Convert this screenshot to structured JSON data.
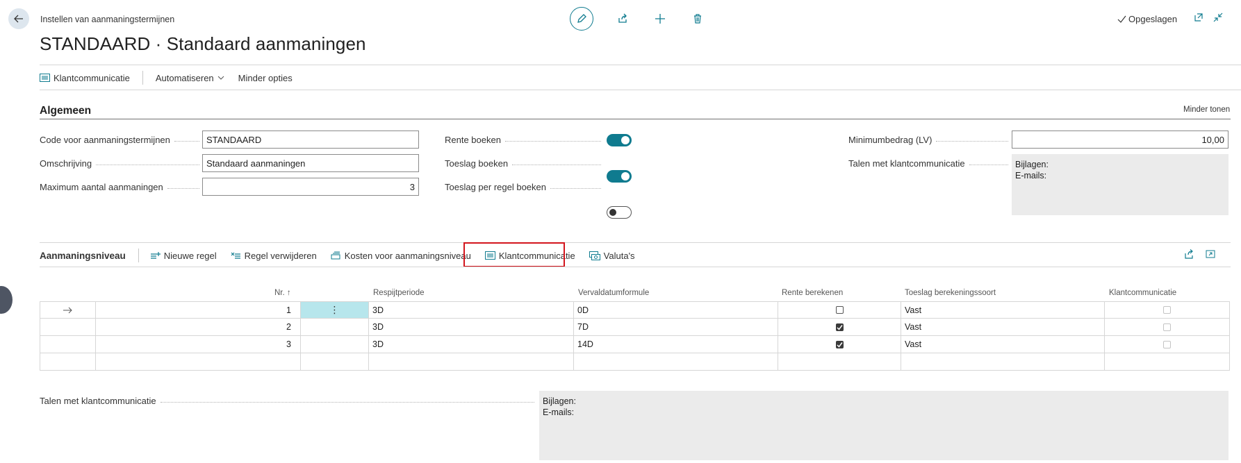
{
  "header": {
    "breadcrumb": "Instellen van aanmaningstermijnen",
    "title": "STANDAARD · Standaard aanmaningen",
    "saved_label": "Opgeslagen"
  },
  "actions": {
    "klantcommunicatie": "Klantcommunicatie",
    "automatiseren": "Automatiseren",
    "minder_opties": "Minder opties"
  },
  "general": {
    "section_title": "Algemeen",
    "less_label": "Minder tonen",
    "code_label": "Code voor aanmaningstermijnen",
    "code_value": "STANDAARD",
    "omschrijving_label": "Omschrijving",
    "omschrijving_value": "Standaard aanmaningen",
    "max_label": "Maximum aantal aanmaningen",
    "max_value": "3",
    "rente_label": "Rente boeken",
    "rente_on": true,
    "toeslag_label": "Toeslag boeken",
    "toeslag_on": true,
    "toeslag_regel_label": "Toeslag per regel boeken",
    "toeslag_regel_on": false,
    "minimum_label": "Minimumbedrag (LV)",
    "minimum_value": "10,00",
    "talen_label": "Talen met klantcommunicatie",
    "bijlagen": "Bijlagen:",
    "emails": "E-mails:"
  },
  "subpage": {
    "title": "Aanmaningsniveau",
    "nieuwe_regel": "Nieuwe regel",
    "regel_verwijderen": "Regel verwijderen",
    "kosten": "Kosten voor aanmaningsniveau",
    "klantcommunicatie": "Klantcommunicatie",
    "valuta": "Valuta's"
  },
  "grid": {
    "columns": {
      "nr": "Nr. ↑",
      "respijt": "Respijtperiode",
      "verval": "Vervaldatumformule",
      "rente": "Rente berekenen",
      "toeslag": "Toeslag berekeningssoort",
      "klant": "Klantcommunicatie"
    },
    "rows": [
      {
        "nr": "1",
        "respijt": "3D",
        "verval": "0D",
        "rente": false,
        "toeslag": "Vast",
        "klant": false
      },
      {
        "nr": "2",
        "respijt": "3D",
        "verval": "7D",
        "rente": true,
        "toeslag": "Vast",
        "klant": false
      },
      {
        "nr": "3",
        "respijt": "3D",
        "verval": "14D",
        "rente": true,
        "toeslag": "Vast",
        "klant": false
      }
    ]
  },
  "footer": {
    "talen_label": "Talen met klantcommunicatie",
    "bijlagen": "Bijlagen:",
    "emails": "E-mails:"
  },
  "colors": {
    "accent": "#0f7b8f",
    "highlight": "#d3141c"
  }
}
